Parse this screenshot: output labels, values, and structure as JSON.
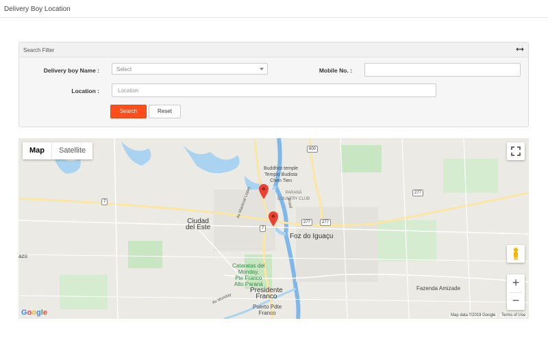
{
  "header": {
    "title": "Delivery Boy Location"
  },
  "filter": {
    "title": "Search Filter",
    "toggle_icon": "collapse-arrows-icon",
    "delivery_boy_label": "Delivery boy Name :",
    "delivery_boy_value": "Select",
    "mobile_label": "Mobile No. :",
    "mobile_value": "",
    "location_label": "Location :",
    "location_placeholder": "Location",
    "search_label": "Search",
    "reset_label": "Reset"
  },
  "map": {
    "type_map": "Map",
    "type_satellite": "Satellite",
    "zoom_in": "+",
    "zoom_out": "−",
    "places": {
      "buddhist": "Buddhist temple\nTemplo Budista\nChen Tien",
      "country_club": "PARANÁ\nCOUNTRY CLUB",
      "ciudad": "Ciudad\ndel Este",
      "foz": "Foz do Iguaçu",
      "cataratas": "Cataratas del\nMonday,\nPte Franco\nAlto Paraná",
      "presidente": "Presidente\nFranco",
      "puerto": "Puerto Pdte\nFranco",
      "fazenda": "Fazenda Amizade",
      "azu": "azú"
    },
    "roads": {
      "lopez": "Av Mariscal Lopez",
      "monday": "Av Monday",
      "brasil": "Brasil"
    },
    "shields": {
      "s600": "600",
      "s7a": "7",
      "s7b": "7",
      "s277a": "277",
      "s277b": "277",
      "s277c": "277"
    },
    "footer": {
      "data": "Map data ©2019 Google",
      "terms": "Terms of Use",
      "logo": "Google"
    },
    "colors": {
      "water": "#a9d3f0",
      "road": "#ffffff",
      "highway": "#fbe6a4",
      "park": "#c8e6c1",
      "marker": "#ea4335"
    }
  }
}
